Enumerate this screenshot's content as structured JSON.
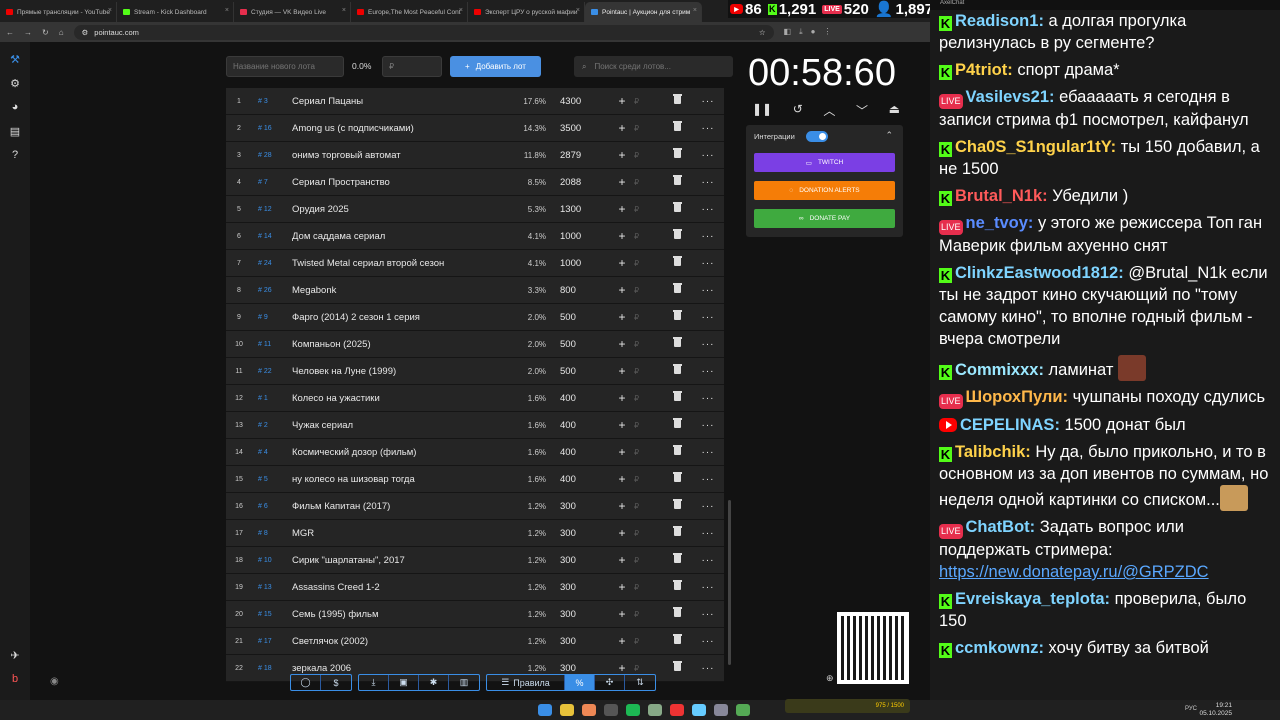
{
  "browser": {
    "tabs": [
      {
        "label": "Прямые трансляции - YouTube",
        "color": "#e00"
      },
      {
        "label": "Stream - Kick Dashboard",
        "color": "#53fc18"
      },
      {
        "label": "Студия — VK Видео Live",
        "color": "#e62e4d"
      },
      {
        "label": "Europe,The Most Peaceful Cont",
        "color": "#e00"
      },
      {
        "label": "Эксперт ЦРУ о русской мафии",
        "color": "#e00"
      },
      {
        "label": "Pointauc | Аукцион для стрим",
        "color": "#3a8ee6"
      }
    ],
    "url": "pointauc.com"
  },
  "stream_stats": {
    "youtube": "86",
    "kick": "1,291",
    "vk": "520",
    "vk_badge": "LIVE",
    "viewers": "1,897"
  },
  "auction": {
    "new_lot_placeholder": "Название нового лота",
    "percent_label": "0.0%",
    "amount_placeholder": "₽",
    "add_button": "Добавить лот",
    "search_placeholder": "Поиск среди лотов...",
    "lots": [
      {
        "n": "1",
        "id": "# 3",
        "name": "Сериал Пацаны",
        "pct": "17.6%",
        "amount": "4300"
      },
      {
        "n": "2",
        "id": "# 16",
        "name": "Among us (с подписчиками)",
        "pct": "14.3%",
        "amount": "3500"
      },
      {
        "n": "3",
        "id": "# 28",
        "name": "онимэ торговый автомат",
        "pct": "11.8%",
        "amount": "2879"
      },
      {
        "n": "4",
        "id": "# 7",
        "name": "Сериал Пространство",
        "pct": "8.5%",
        "amount": "2088"
      },
      {
        "n": "5",
        "id": "# 12",
        "name": "Орудия 2025",
        "pct": "5.3%",
        "amount": "1300"
      },
      {
        "n": "6",
        "id": "# 14",
        "name": "Дом саддама сериал",
        "pct": "4.1%",
        "amount": "1000"
      },
      {
        "n": "7",
        "id": "# 24",
        "name": "Twisted Metal сериал второй сезон",
        "pct": "4.1%",
        "amount": "1000"
      },
      {
        "n": "8",
        "id": "# 26",
        "name": "Megabonk",
        "pct": "3.3%",
        "amount": "800"
      },
      {
        "n": "9",
        "id": "# 9",
        "name": "Фарго (2014) 2 сезон 1 серия",
        "pct": "2.0%",
        "amount": "500"
      },
      {
        "n": "10",
        "id": "# 11",
        "name": "Компаньон (2025)",
        "pct": "2.0%",
        "amount": "500"
      },
      {
        "n": "11",
        "id": "# 22",
        "name": "Человек на Луне (1999)",
        "pct": "2.0%",
        "amount": "500"
      },
      {
        "n": "12",
        "id": "# 1",
        "name": "Колесо на ужастики",
        "pct": "1.6%",
        "amount": "400"
      },
      {
        "n": "13",
        "id": "# 2",
        "name": "Чужак сериал",
        "pct": "1.6%",
        "amount": "400"
      },
      {
        "n": "14",
        "id": "# 4",
        "name": "Космический дозор (фильм)",
        "pct": "1.6%",
        "amount": "400"
      },
      {
        "n": "15",
        "id": "# 5",
        "name": "ну колесо на шизовар тогда",
        "pct": "1.6%",
        "amount": "400"
      },
      {
        "n": "16",
        "id": "# 6",
        "name": "Фильм Капитан (2017)",
        "pct": "1.2%",
        "amount": "300"
      },
      {
        "n": "17",
        "id": "# 8",
        "name": "MGR",
        "pct": "1.2%",
        "amount": "300"
      },
      {
        "n": "18",
        "id": "# 10",
        "name": "Сирик \"шарлатаны\", 2017",
        "pct": "1.2%",
        "amount": "300"
      },
      {
        "n": "19",
        "id": "# 13",
        "name": "Assassins Creed 1-2",
        "pct": "1.2%",
        "amount": "300"
      },
      {
        "n": "20",
        "id": "# 15",
        "name": "Семь (1995) фильм",
        "pct": "1.2%",
        "amount": "300"
      },
      {
        "n": "21",
        "id": "# 17",
        "name": "Светлячок (2002)",
        "pct": "1.2%",
        "amount": "300"
      },
      {
        "n": "22",
        "id": "# 18",
        "name": "зеркала 2006",
        "pct": "1.2%",
        "amount": "300"
      }
    ],
    "currency_symbol": "₽",
    "timer": "00:58:60",
    "integrations_label": "Интеграции",
    "integrations": [
      {
        "label": "TWITCH",
        "color": "#7b3fe4"
      },
      {
        "label": "DONATION ALERTS",
        "color": "#f57d07"
      },
      {
        "label": "DONATE PAY",
        "color": "#3faa3f"
      }
    ],
    "bottom_rules_label": "Правила"
  },
  "taskbar": {
    "lang": "РУС",
    "time": "19:21",
    "date": "05.10.2025",
    "widget": "975 / 1500"
  },
  "chat": {
    "window_title": "AxelChat",
    "messages": [
      {
        "platform": "kick",
        "user": "Readison1",
        "color": "#7fd4ff",
        "text": "а долгая прогулка релизнулась в ру сегменте?"
      },
      {
        "platform": "kick",
        "user": "P4triot",
        "color": "#ffd24a",
        "text": "спорт драма*"
      },
      {
        "platform": "vk",
        "user": "Vasilevs21",
        "color": "#7fd4ff",
        "text": "ебааааать я сегодня в записи стрима ф1 посмотрел, кайфанул"
      },
      {
        "platform": "kick",
        "user": "Cha0S_S1ngular1tY",
        "color": "#ffd24a",
        "text": "ты 150 добавил, а не 1500"
      },
      {
        "platform": "kick",
        "user": "Brutal_N1k",
        "color": "#ff5a5a",
        "text": "Убедили )"
      },
      {
        "platform": "vk",
        "user": "ne_tvoy",
        "color": "#5a8cff",
        "text": "у этого же режиссера Топ ган Маверик фильм ахуенно снят"
      },
      {
        "platform": "kick",
        "user": "ClinkzEastwood1812",
        "color": "#7fd4ff",
        "text": "@Brutal_N1k если ты не задрот кино скучающий по \"тому самому кино\", то вполне годный фильм - вчера смотрели"
      },
      {
        "platform": "kick",
        "user": "Commixxx",
        "color": "#9be8ff",
        "text": "ламинат"
      },
      {
        "platform": "vk",
        "user": "ШорохПули",
        "color": "#ffb84a",
        "text": "чушпаны походу сдулись"
      },
      {
        "platform": "youtube",
        "user": "CEPELINAS",
        "color": "#7fd4ff",
        "text": "1500 донат был"
      },
      {
        "platform": "kick",
        "user": "Talibchik",
        "color": "#ffd24a",
        "text": "Ну да, было прикольно, и то в основном из за доп ивентов по суммам, но неделя одной картинки со списком..."
      },
      {
        "platform": "vk",
        "user": "ChatBot",
        "color": "#7fd4ff",
        "text": "Задать вопрос или поддержать стримера:",
        "link": "https://new.donatepay.ru/@GRPZDC"
      },
      {
        "platform": "kick",
        "user": "Evreiskaya_teplota",
        "color": "#7fd4ff",
        "text": "проверила, было 150"
      },
      {
        "platform": "kick",
        "user": "ccmkownz",
        "color": "#7fd4ff",
        "text": "хочу битву за битвой"
      }
    ]
  }
}
